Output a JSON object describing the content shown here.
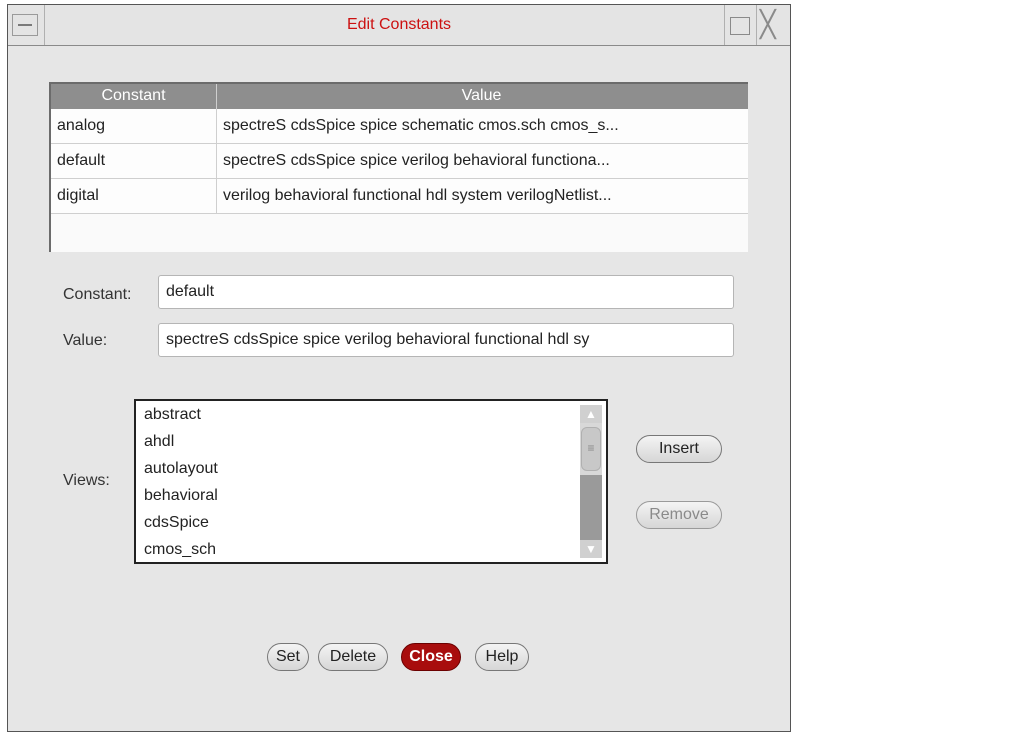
{
  "window": {
    "title": "Edit Constants"
  },
  "table": {
    "headers": [
      "Constant",
      "Value"
    ],
    "rows": [
      {
        "constant": "analog",
        "value": "spectreS cdsSpice spice schematic cmos.sch cmos_s..."
      },
      {
        "constant": "default",
        "value": "spectreS cdsSpice spice verilog behavioral functiona..."
      },
      {
        "constant": "digital",
        "value": "verilog behavioral functional hdl system verilogNetlist..."
      }
    ]
  },
  "form": {
    "constant_label": "Constant:",
    "constant_value": "default",
    "value_label": "Value:",
    "value_value": "spectreS cdsSpice spice verilog behavioral functional hdl sy",
    "views_label": "Views:"
  },
  "views": {
    "items": [
      "abstract",
      "ahdl",
      "autolayout",
      "behavioral",
      "cdsSpice",
      "cmos_sch"
    ]
  },
  "buttons": {
    "insert": "Insert",
    "remove": "Remove",
    "set": "Set",
    "delete": "Delete",
    "close": "Close",
    "help": "Help"
  },
  "colors": {
    "title_text": "#cc1111",
    "close_button": "#a80d0d",
    "table_header": "#8e8e8e"
  }
}
